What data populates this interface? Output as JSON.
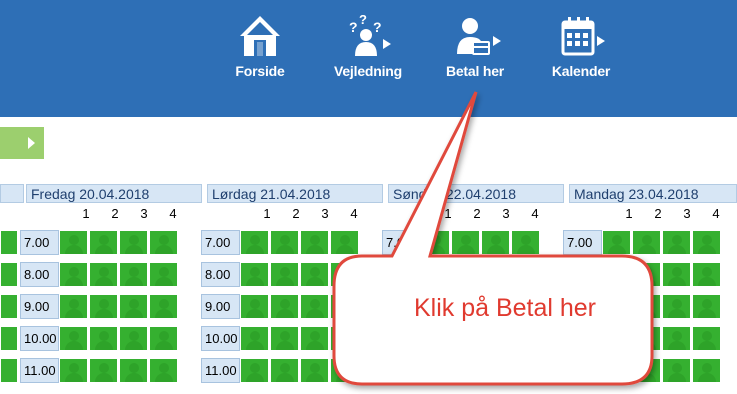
{
  "colors": {
    "header_bg": "#2e6fb6",
    "slot_green": "#35b030",
    "day_header_bg": "#d7e6f5",
    "callout_border": "#e04a3c",
    "callout_text": "#e03a2f"
  },
  "nav": [
    {
      "label": "Forside",
      "icon": "house-icon"
    },
    {
      "label": "Vejledning",
      "icon": "help-person-icon"
    },
    {
      "label": "Betal her",
      "icon": "person-card-icon"
    },
    {
      "label": "Kalender",
      "icon": "calendar-icon"
    }
  ],
  "days": [
    {
      "label": "Fredag 20.04.2018"
    },
    {
      "label": "Lørdag 21.04.2018"
    },
    {
      "label": "Søndag 22.04.2018"
    },
    {
      "label": "Mandag 23.04.2018"
    }
  ],
  "columns": [
    "1",
    "2",
    "3",
    "4"
  ],
  "times": [
    "7.00",
    "8.00",
    "9.00",
    "10.00",
    "11.00"
  ],
  "callout": {
    "text": "Klik på Betal her"
  }
}
